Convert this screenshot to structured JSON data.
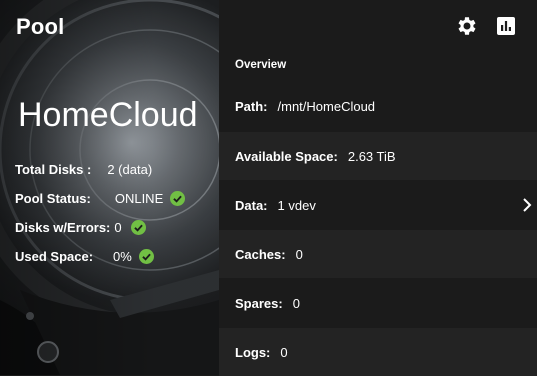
{
  "header": {
    "title": "Pool"
  },
  "pool": {
    "name": "HomeCloud"
  },
  "stats": [
    {
      "label": "Total Disks :",
      "value": "2 (data)",
      "ok": false
    },
    {
      "label": "Pool Status:",
      "value": "ONLINE",
      "ok": true
    },
    {
      "label": "Disks w/Errors:",
      "value": "0",
      "ok": true
    },
    {
      "label": "Used Space:",
      "value": "0%",
      "ok": true
    }
  ],
  "toolbar": {
    "settings_icon": "gear-icon",
    "stats_icon": "bar-chart-icon"
  },
  "overview": {
    "title": "Overview",
    "rows": [
      {
        "label": "Path:",
        "value": "/mnt/HomeCloud"
      },
      {
        "label": "Available Space:",
        "value": "2.63 TiB"
      },
      {
        "label": "Data:",
        "value": "1 vdev",
        "chevron": true
      },
      {
        "label": "Caches:",
        "value": "0"
      },
      {
        "label": "Spares:",
        "value": "0"
      },
      {
        "label": "Logs:",
        "value": "0"
      }
    ]
  },
  "colors": {
    "ok_green": "#71bf44",
    "background": "#1b1b1b",
    "alt_row": "#232323"
  }
}
